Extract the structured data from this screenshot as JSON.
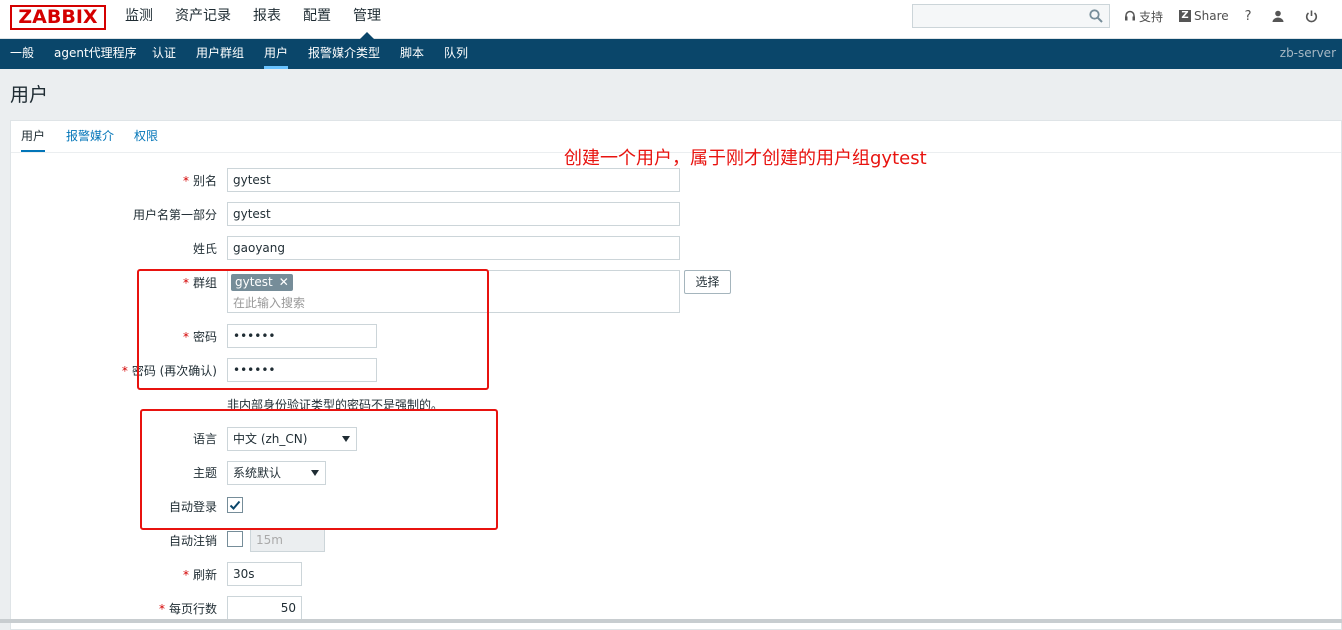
{
  "brand": "ZABBIX",
  "main_nav": [
    "监测",
    "资产记录",
    "报表",
    "配置",
    "管理"
  ],
  "search": {
    "value": "",
    "placeholder": ""
  },
  "top_tools": {
    "support": "支持",
    "share": "Share",
    "help": "?"
  },
  "sub_nav": [
    "一般",
    "agent代理程序",
    "认证",
    "用户群组",
    "用户",
    "报警媒介类型",
    "脚本",
    "队列"
  ],
  "server_name": "zb-server",
  "page_title": "用户",
  "tabs": [
    "用户",
    "报警媒介",
    "权限"
  ],
  "annotation": "创建一个用户，属于刚才创建的用户组gytest",
  "form": {
    "alias_label": "别名",
    "alias_value": "gytest",
    "name_label": "用户名第一部分",
    "name_value": "gytest",
    "surname_label": "姓氏",
    "surname_value": "gaoyang",
    "groups_label": "群组",
    "group_chip": "gytest",
    "groups_placeholder": "在此输入搜索",
    "select_button": "选择",
    "password_label": "密码",
    "password_value": "••••••",
    "password2_label": "密码 (再次确认)",
    "password2_value": "••••••",
    "password_hint": "非内部身份验证类型的密码不是强制的。",
    "language_label": "语言",
    "language_value": "中文 (zh_CN)",
    "theme_label": "主题",
    "theme_value": "系统默认",
    "autologin_label": "自动登录",
    "autologin_checked": true,
    "autologout_label": "自动注销",
    "autologout_checked": false,
    "autologout_value": "15m",
    "refresh_label": "刷新",
    "refresh_value": "30s",
    "rows_label": "每页行数",
    "rows_value": "50"
  },
  "colors": {
    "accent": "#0a466a",
    "link": "#0275b8",
    "annotation": "#e8130f",
    "brand": "#d40000"
  }
}
